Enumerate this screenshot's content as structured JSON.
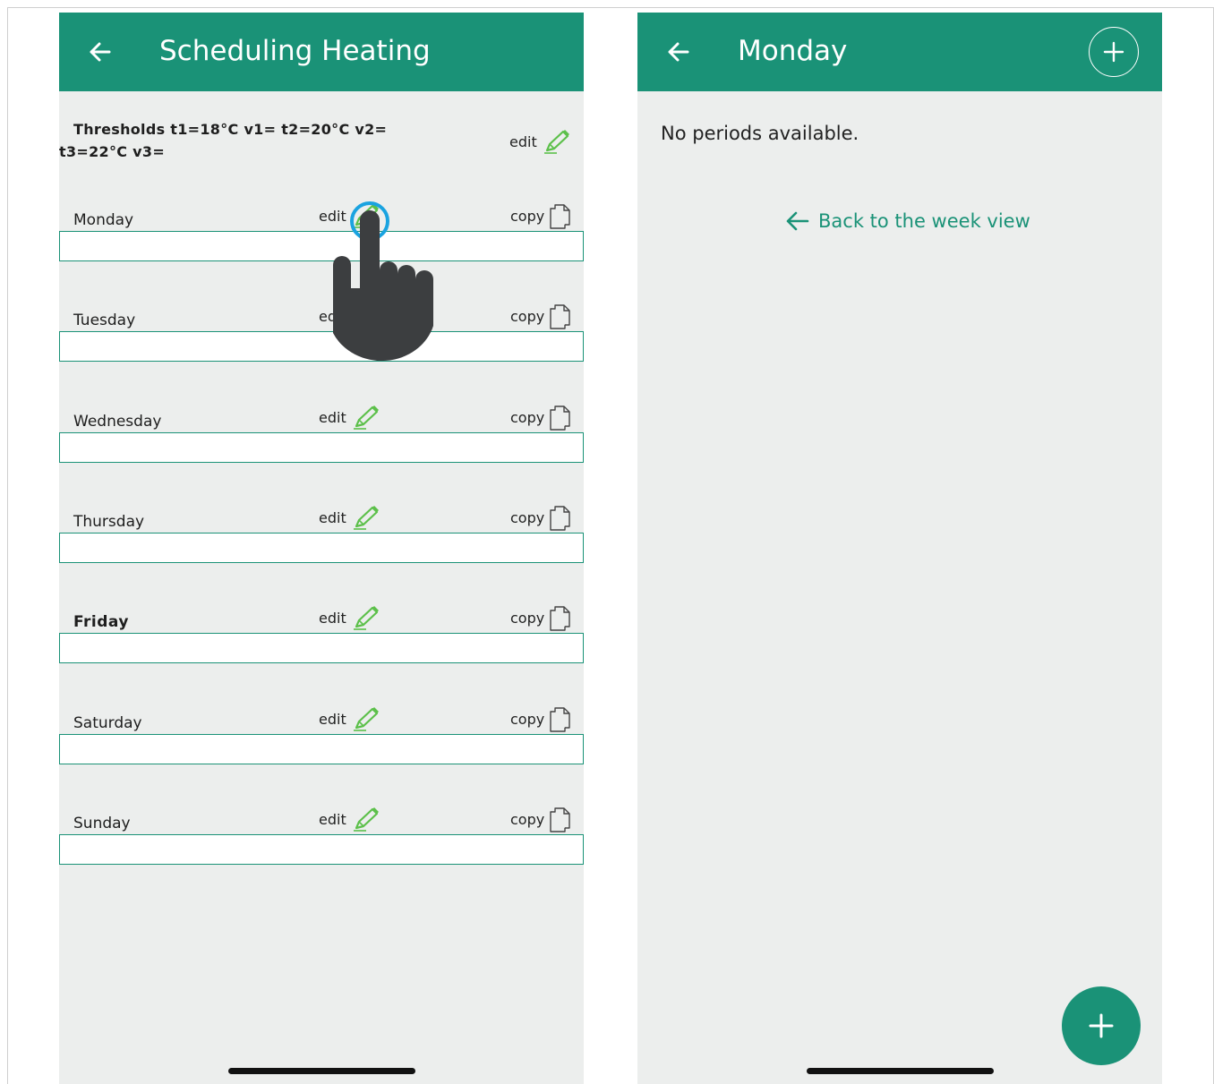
{
  "left_screen": {
    "header": {
      "title": "Scheduling Heating",
      "back_icon": "arrow-left-icon"
    },
    "thresholds": {
      "line1": "Thresholds t1=18°C v1= t2=20°C v2=",
      "line2": "t3=22°C v3=",
      "edit_label": "edit"
    },
    "days": [
      {
        "name": "Monday",
        "edit_label": "edit",
        "copy_label": "copy",
        "bold": false
      },
      {
        "name": "Tuesday",
        "edit_label": "ed",
        "copy_label": "copy",
        "bold": false
      },
      {
        "name": "Wednesday",
        "edit_label": "edit",
        "copy_label": "copy",
        "bold": false
      },
      {
        "name": "Thursday",
        "edit_label": "edit",
        "copy_label": "copy",
        "bold": false
      },
      {
        "name": "Friday",
        "edit_label": "edit",
        "copy_label": "copy",
        "bold": true
      },
      {
        "name": "Saturday",
        "edit_label": "edit",
        "copy_label": "copy",
        "bold": false
      },
      {
        "name": "Sunday",
        "edit_label": "edit",
        "copy_label": "copy",
        "bold": false
      }
    ]
  },
  "right_screen": {
    "header": {
      "title": "Monday",
      "back_icon": "arrow-left-icon",
      "add_icon": "plus-circle-icon"
    },
    "empty_message": "No periods available.",
    "back_link": "Back to the week view",
    "fab_icon": "plus-icon"
  },
  "colors": {
    "primary": "#1a9277",
    "background": "#eceeed",
    "pencil": "#5cc04a",
    "tap_highlight": "#1aa3e0",
    "hand": "#3c3e40"
  }
}
